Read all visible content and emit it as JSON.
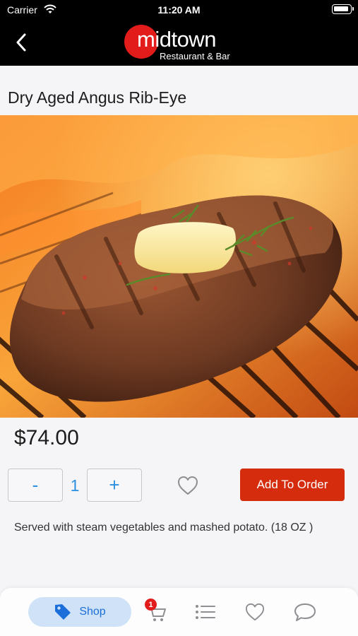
{
  "status_bar": {
    "carrier": "Carrier",
    "time": "11:20 AM"
  },
  "header": {
    "back_icon": "chevron-left-icon",
    "logo_name": "midtown",
    "logo_subtitle": "Restaurant & Bar",
    "logo_color": "#e21b1b"
  },
  "product": {
    "title": "Dry Aged Angus Rib-Eye",
    "image_subject": "ribeye-steak-on-grill-photo",
    "price": "$74.00",
    "description": "Served with steam vegetables and mashed potato. (18 OZ )"
  },
  "order_controls": {
    "decrement_label": "-",
    "quantity": "1",
    "increment_label": "+",
    "favorite_icon": "heart-outline-icon",
    "add_button_label": "Add To Order",
    "accent_color": "#2c8fe0",
    "add_button_color": "#d52c0e"
  },
  "tab_bar": {
    "shop": {
      "label": "Shop",
      "icon": "tag-icon",
      "active": true
    },
    "cart": {
      "icon": "cart-icon",
      "badge": "1"
    },
    "list_icon": "list-icon",
    "favorites_icon": "heart-icon",
    "chat_icon": "chat-bubble-icon",
    "active_color": "#1c6fd8"
  }
}
